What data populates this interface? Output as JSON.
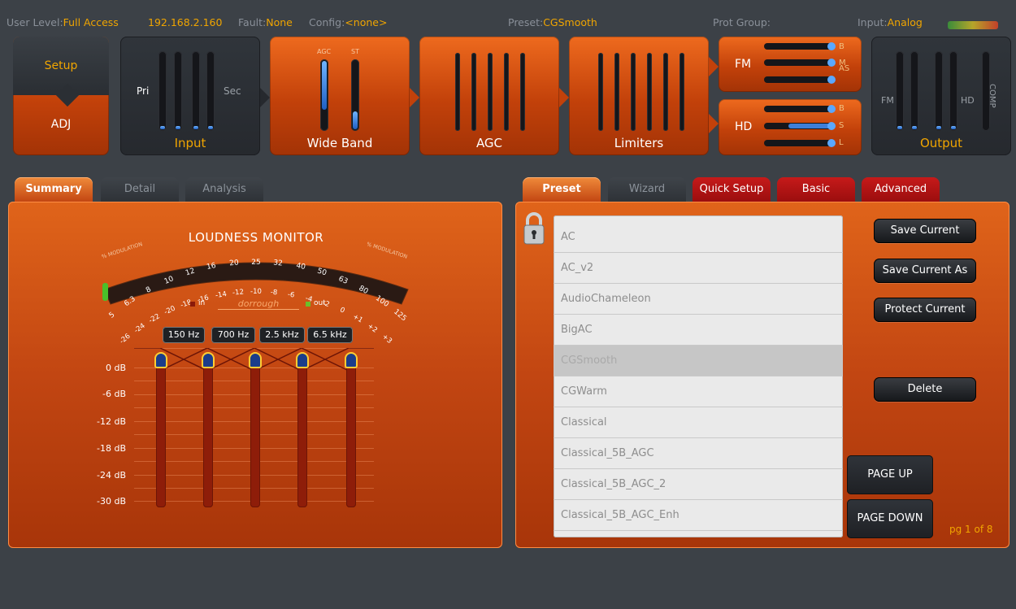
{
  "status": {
    "user_level_label": "User Level:",
    "user_level_value": "Full Access",
    "ip": "192.168.2.160",
    "fault_label": "Fault:",
    "fault_value": "None",
    "config_label": "Config:",
    "config_value": "<none>",
    "preset_label": "Preset:",
    "preset_value": "CGSmooth",
    "prot_group_label": "Prot Group:",
    "input_label": "Input:",
    "input_value": "Analog"
  },
  "pipeline": {
    "setup_label": "Setup",
    "adj_label": "ADJ",
    "input_pri": "Pri",
    "input_sec": "Sec",
    "input_label": "Input",
    "wideband_agc": "AGC",
    "wideband_st": "ST",
    "wideband_label": "Wide Band",
    "agc_label": "AGC",
    "limiters_label": "Limiters",
    "fm_label": "FM",
    "fm_bars": [
      "B",
      "M",
      "AS"
    ],
    "hd_label": "HD",
    "hd_bars": [
      "B",
      "S",
      "L"
    ],
    "output_fm": "FM",
    "output_hd": "HD",
    "output_comp": "COMP",
    "output_label": "Output"
  },
  "left_tabs": [
    "Summary",
    "Detail",
    "Analysis"
  ],
  "loudness": {
    "title": "LOUDNESS MONITOR",
    "mod_left": "% MODULATION",
    "mod_right": "% MODULATION",
    "top_scale": [
      "5",
      "6.3",
      "8",
      "10",
      "12",
      "16",
      "20",
      "25",
      "32",
      "40",
      "50",
      "63",
      "80",
      "100",
      "125"
    ],
    "bottom_scale": [
      "-26",
      "-24",
      "-22",
      "-20",
      "-18",
      "-16",
      "-14",
      "-12",
      "-10",
      "-8",
      "-6",
      "-4",
      "-2",
      "0",
      "+1",
      "+2",
      "+3"
    ],
    "legend_in": "in",
    "legend_out": "out",
    "brand": "dorrough",
    "level": 0.02
  },
  "eq": {
    "freqs": [
      "150 Hz",
      "700 Hz",
      "2.5 kHz",
      "6.5 kHz"
    ],
    "db_labels": [
      "0 dB",
      "-6 dB",
      "-12 dB",
      "-18 dB",
      "-24 dB",
      "-30 dB"
    ]
  },
  "right_tabs": [
    "Preset",
    "Wizard",
    "Quick Setup",
    "Basic",
    "Advanced"
  ],
  "presets": {
    "items": [
      "AC",
      "AC_v2",
      "AudioChameleon",
      "BigAC",
      "CGSmooth",
      "CGWarm",
      "Classical",
      "Classical_5B_AGC",
      "Classical_5B_AGC_2",
      "Classical_5B_AGC_Enh"
    ],
    "selected": "CGSmooth"
  },
  "buttons": {
    "save_current": "Save Current",
    "save_current_as": "Save Current As",
    "protect_current": "Protect Current",
    "delete": "Delete",
    "page_up": "PAGE UP",
    "page_down": "PAGE DOWN"
  },
  "pager": "pg 1 of 8"
}
